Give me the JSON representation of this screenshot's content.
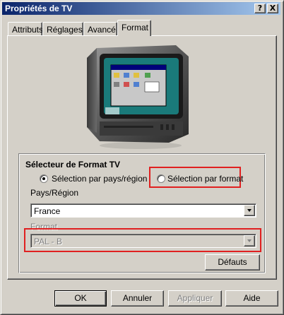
{
  "window": {
    "title": "Propriétés de TV",
    "help_label": "?",
    "close_label": "X"
  },
  "tabs": [
    {
      "label": "Attributs",
      "selected": false
    },
    {
      "label": "Réglages",
      "selected": false
    },
    {
      "label": "Avancé",
      "selected": false
    },
    {
      "label": "Format",
      "selected": true
    }
  ],
  "format_selector": {
    "title": "Sélecteur de Format TV",
    "options": [
      {
        "label": "Sélection par pays/région",
        "selected": true
      },
      {
        "label": "Sélection par format",
        "selected": false
      }
    ],
    "country_label": "Pays/Région",
    "country_value": "France",
    "format_label": "Format",
    "format_value": "PAL - B",
    "format_enabled": false,
    "defaults_label": "Défauts"
  },
  "buttons": {
    "ok": "OK",
    "cancel": "Annuler",
    "apply": "Appliquer",
    "help": "Aide"
  },
  "colors": {
    "face": "#d4d0c8",
    "title_start": "#0a246a",
    "title_end": "#a6caf0",
    "highlight": "#e02020"
  },
  "icons": {
    "tv": "television-icon",
    "help": "help-icon",
    "close": "close-icon"
  }
}
